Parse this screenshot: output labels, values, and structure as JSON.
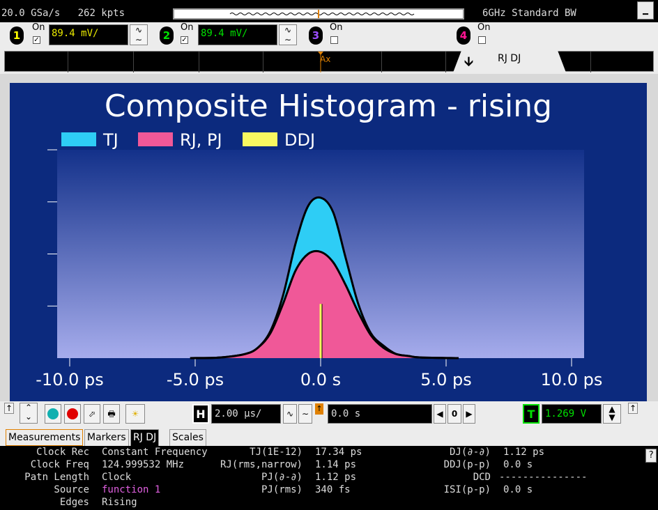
{
  "status": {
    "sample_rate": "20.0 GSa/s",
    "points": "262 kpts",
    "bandwidth": "6GHz Standard BW"
  },
  "channels": [
    {
      "num": "1",
      "on_label": "On",
      "checked": true,
      "scale": "89.4 mV/",
      "color": "#ffff00"
    },
    {
      "num": "2",
      "on_label": "On",
      "checked": true,
      "scale": "89.4 mV/",
      "color": "#00e000"
    },
    {
      "num": "3",
      "on_label": "On",
      "checked": false,
      "color": "#8a2be2"
    },
    {
      "num": "4",
      "on_label": "On",
      "checked": false,
      "color": "#ff1493"
    }
  ],
  "marker_strip": {
    "marker_label": "Ax",
    "tab_label": "RJ DJ"
  },
  "graph": {
    "title": "Composite Histogram - rising",
    "legend": [
      {
        "label": "TJ",
        "color": "#2ecdf5"
      },
      {
        "label": "RJ, PJ",
        "color": "#f05898"
      },
      {
        "label": "DDJ",
        "color": "#f8f860"
      }
    ],
    "x_ticks": [
      "-10.0 ps",
      "-5.0 ps",
      "0.0 s",
      "5.0 ps",
      "10.0 ps"
    ]
  },
  "chart_data": {
    "type": "area",
    "title": "Composite Histogram - rising",
    "xlabel": "",
    "ylabel": "",
    "xlim": [
      -10.5,
      10.5
    ],
    "ylim": [
      0,
      1.0
    ],
    "x_tick_labels": [
      "-10.0 ps",
      "-5.0 ps",
      "0.0 s",
      "5.0 ps",
      "10.0 ps"
    ],
    "x_tick_values": [
      -10,
      -5,
      0,
      5,
      10
    ],
    "series": [
      {
        "name": "TJ",
        "color": "#2ecdf5",
        "x": [
          -5.2,
          -4,
          -3,
          -2.5,
          -2,
          -1.5,
          -1,
          -0.5,
          0,
          0.5,
          1,
          1.5,
          2,
          2.5,
          3,
          3.5,
          4,
          5.5
        ],
        "y": [
          0,
          0.003,
          0.02,
          0.05,
          0.13,
          0.3,
          0.55,
          0.73,
          0.77,
          0.7,
          0.48,
          0.26,
          0.12,
          0.06,
          0.02,
          0.01,
          0.003,
          0
        ]
      },
      {
        "name": "RJ, PJ",
        "color": "#f05898",
        "x": [
          -5.2,
          -4,
          -3,
          -2.5,
          -2,
          -1.5,
          -1,
          -0.5,
          0,
          0.5,
          1,
          1.5,
          2,
          2.5,
          3,
          3.5,
          4,
          5.5
        ],
        "y": [
          0,
          0.003,
          0.02,
          0.05,
          0.12,
          0.26,
          0.42,
          0.5,
          0.51,
          0.46,
          0.35,
          0.22,
          0.11,
          0.05,
          0.02,
          0.01,
          0.003,
          0
        ]
      },
      {
        "name": "DDJ",
        "color": "#f8f860",
        "x": [
          0.0
        ],
        "y": [
          0.26
        ]
      }
    ]
  },
  "controls": {
    "h_label": "H",
    "timebase": "2.00 µs/",
    "delay": "0.0 s",
    "delay_ref": "0",
    "t_label": "T",
    "trigger_level": "1.269 V"
  },
  "tabs": [
    "Measurements",
    "Markers",
    "RJ DJ",
    "Scales"
  ],
  "selected_tab": "RJ DJ",
  "measurements": {
    "left": [
      {
        "label": "Clock Rec",
        "value": "Constant Frequency"
      },
      {
        "label": "Clock Freq",
        "value": "124.999532 MHz"
      },
      {
        "label": "Patn Length",
        "value": "Clock"
      },
      {
        "label": "Source",
        "value": "function 1",
        "value_color": "#e060e0"
      },
      {
        "label": "Edges",
        "value": "Rising"
      }
    ],
    "middle": [
      {
        "label": "TJ(1E-12)",
        "value": "17.34 ps"
      },
      {
        "label": "RJ(rms,narrow)",
        "value": "1.14 ps"
      },
      {
        "label": "PJ(∂-∂)",
        "value": "1.12 ps"
      },
      {
        "label": "PJ(rms)",
        "value": "340 fs"
      }
    ],
    "right": [
      {
        "label": "DJ(∂-∂)",
        "value": "1.12 ps"
      },
      {
        "label": "DDJ(p-p)",
        "value": "0.0 s"
      },
      {
        "label": "DCD",
        "value": "---------------"
      },
      {
        "label": "ISI(p-p)",
        "value": "0.0 s"
      }
    ]
  },
  "help_label": "?"
}
